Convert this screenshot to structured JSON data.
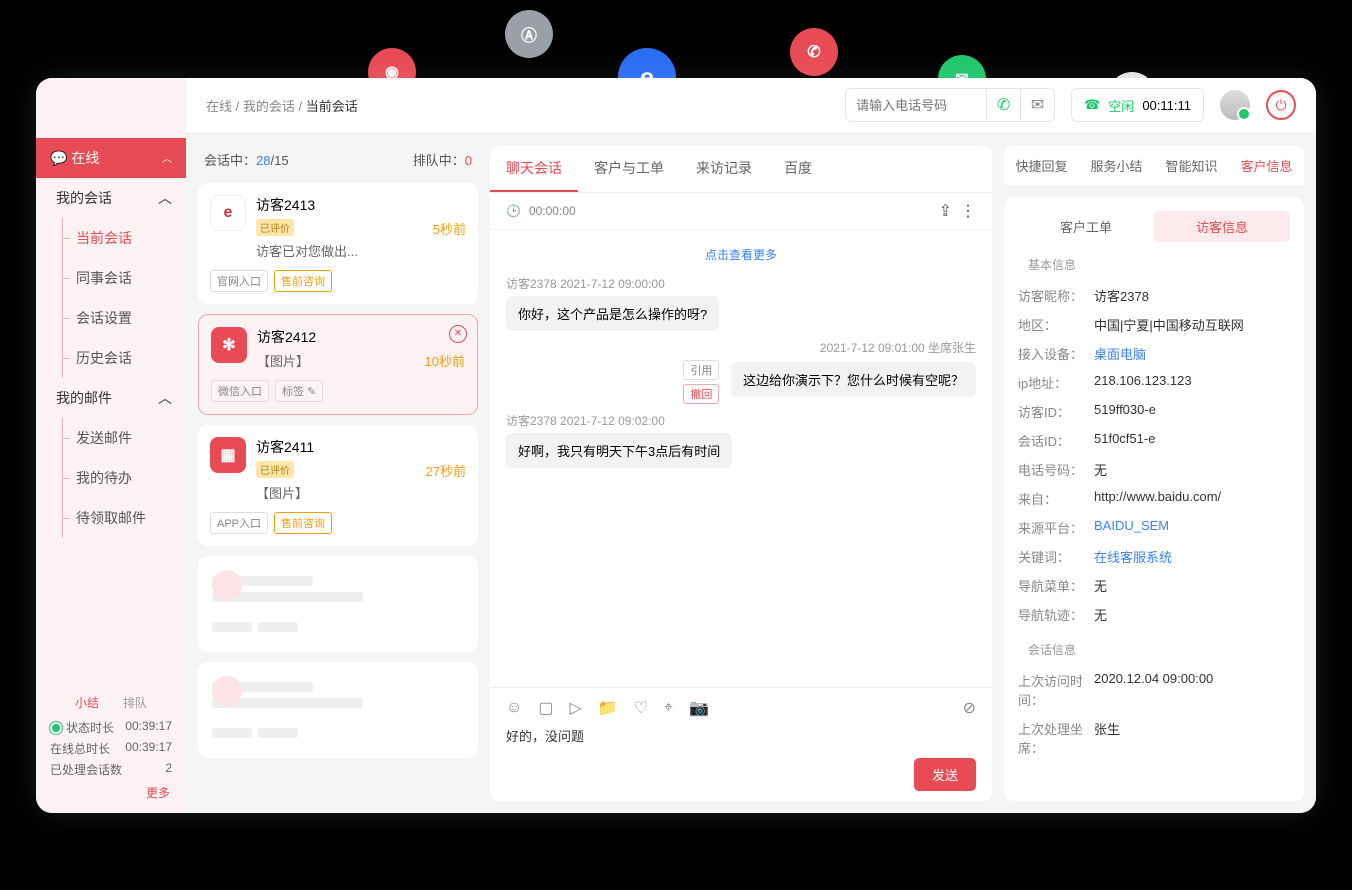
{
  "breadcrumb": {
    "a": "在线",
    "b": "我的会话",
    "c": "当前会话"
  },
  "topbar": {
    "phone_placeholder": "请输入电话号码",
    "status_label": "空闲",
    "status_time": "00:11:11"
  },
  "sidebar": {
    "online": "在线",
    "my_sessions": "我的会话",
    "items": [
      "当前会话",
      "同事会话",
      "会话设置",
      "历史会话"
    ],
    "my_mail": "我的邮件",
    "mail_items": [
      "发送邮件",
      "我的待办",
      "待领取邮件"
    ],
    "footer_tabs": {
      "summary": "小结",
      "queue": "排队"
    },
    "status_rows": [
      {
        "label": "状态时长",
        "value": "00:39:17"
      },
      {
        "label": "在线总时长",
        "value": "00:39:17"
      },
      {
        "label": "已处理会话数",
        "value": "2"
      }
    ],
    "more": "更多"
  },
  "list": {
    "in_session_label": "会话中：",
    "in_session_a": "28",
    "in_session_b": "/15",
    "queue_label": "排队中：",
    "queue_count": "0",
    "cards": [
      {
        "name": "访客2413",
        "preview": "访客已对您做出...",
        "time": "5秒前",
        "rated": "已评价",
        "tags": [
          "官网入口",
          "售前咨询"
        ],
        "icon_bg": "#fff",
        "icon_txt": "e",
        "icon_color": "#d13434",
        "tag_styles": [
          "",
          "orange"
        ]
      },
      {
        "name": "访客2412",
        "preview": "【图片】",
        "time": "10秒前",
        "rated": "",
        "tags": [
          "微信入口",
          "标签 ✎"
        ],
        "icon_bg": "#e94b55",
        "icon_txt": "✻",
        "icon_color": "#fff",
        "tag_styles": [
          "",
          ""
        ],
        "selected": true
      },
      {
        "name": "访客2411",
        "preview": "【图片】",
        "time": "27秒前",
        "rated": "已评价",
        "tags": [
          "APP入口",
          "售前咨询"
        ],
        "icon_bg": "#e94b55",
        "icon_txt": "▦",
        "icon_color": "#fff",
        "tag_styles": [
          "",
          "orange"
        ]
      }
    ]
  },
  "chat": {
    "tabs": [
      "聊天会话",
      "客户与工单",
      "来访记录",
      "百度"
    ],
    "timer": "00:00:00",
    "load_more": "点击查看更多",
    "messages": [
      {
        "side": "left",
        "meta": "访客2378  2021-7-12 09:00:00",
        "text": "你好，这个产品是怎么操作的呀?"
      },
      {
        "side": "right",
        "meta": "2021-7-12 09:01:00  坐席张生",
        "text": "这边给你演示下？您什么时候有空呢？",
        "actions": [
          "引用",
          "撤回"
        ]
      },
      {
        "side": "left",
        "meta": "访客2378  2021-7-12 09:02:00",
        "text": "好啊，我只有明天下午3点后有时间"
      }
    ],
    "input_text": "好的，没问题",
    "send": "发送"
  },
  "info": {
    "top_tabs": [
      "快捷回复",
      "服务小结",
      "智能知识",
      "客户信息"
    ],
    "subtabs": [
      "客户工单",
      "访客信息"
    ],
    "sections": {
      "basic_title": "基本信息",
      "basic": [
        {
          "k": "访客昵称：",
          "v": "访客2378"
        },
        {
          "k": "地区：",
          "v": "中国|宁夏|中国移动互联网"
        },
        {
          "k": "接入设备：",
          "v": "桌面电脑",
          "link": true
        },
        {
          "k": "ip地址：",
          "v": "218.106.123.123"
        },
        {
          "k": "访客ID：",
          "v": "519ff030-e"
        },
        {
          "k": "会话ID：",
          "v": "51f0cf51-e"
        },
        {
          "k": "电话号码：",
          "v": "无"
        },
        {
          "k": "来自：",
          "v": "http://www.baidu.com/"
        },
        {
          "k": "来源平台：",
          "v": "BAIDU_SEM",
          "link": true
        },
        {
          "k": "关键词：",
          "v": "在线客服系统",
          "link": true
        },
        {
          "k": "导航菜单：",
          "v": "无"
        },
        {
          "k": "导航轨迹：",
          "v": "无"
        }
      ],
      "session_title": "会话信息",
      "session": [
        {
          "k": "上次访问时间：",
          "v": "2020.12.04 09:00:00"
        },
        {
          "k": "上次处理坐席：",
          "v": "张生"
        }
      ]
    }
  }
}
